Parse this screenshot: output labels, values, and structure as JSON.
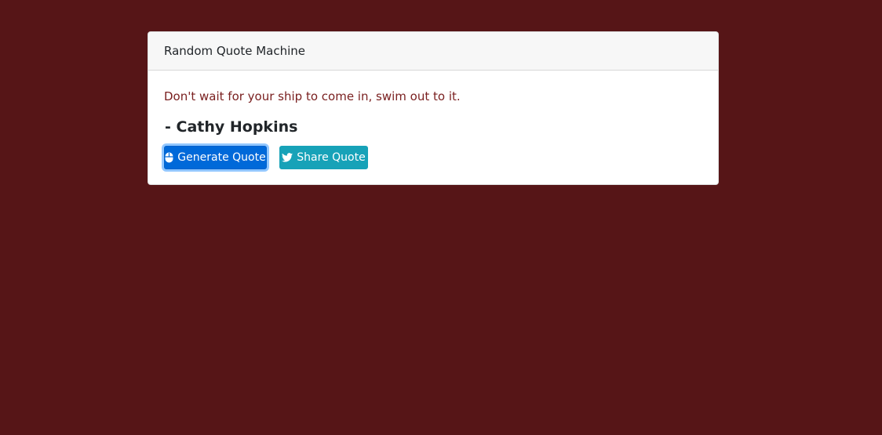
{
  "colors": {
    "page_background": "#561517",
    "quote_text": "#7a2020",
    "generate_button": "#0069d9",
    "share_button": "#17a2b8"
  },
  "card": {
    "header_title": "Random Quote Machine",
    "quote": "Don't wait for your ship to come in, swim out to it.",
    "author": "- Cathy Hopkins"
  },
  "buttons": {
    "generate": {
      "label": "Generate Quote",
      "icon": "mouse-icon"
    },
    "share": {
      "label": "Share Quote",
      "icon": "twitter-icon"
    }
  }
}
